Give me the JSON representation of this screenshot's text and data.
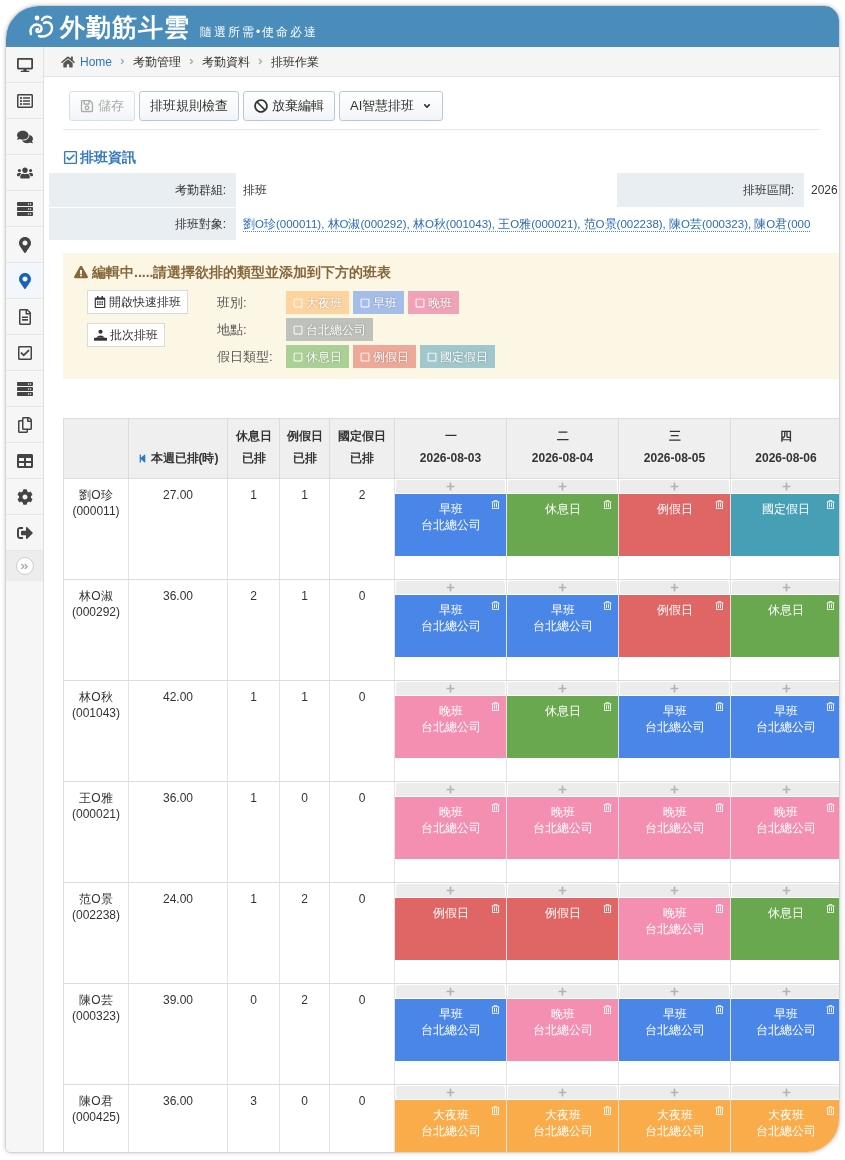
{
  "header": {
    "logo_text": "外勤筋斗雲",
    "tagline": "隨選所需•使命必達"
  },
  "sidebar": {
    "items": [
      {
        "selected": false
      },
      {
        "selected": false
      },
      {
        "selected": false
      },
      {
        "selected": false
      },
      {
        "selected": false
      },
      {
        "selected": false
      },
      {
        "selected": true
      },
      {
        "selected": false
      },
      {
        "selected": false
      },
      {
        "selected": false
      },
      {
        "selected": false
      },
      {
        "selected": false
      },
      {
        "selected": false
      },
      {
        "selected": false
      }
    ]
  },
  "breadcrumb": [
    "Home",
    "考勤管理",
    "考勤資料",
    "排班作業"
  ],
  "toolbar": [
    {
      "label": "儲存",
      "kind": "save",
      "disabled": true
    },
    {
      "label": "排班規則檢查",
      "kind": "check",
      "disabled": false
    },
    {
      "label": "放棄編輯",
      "kind": "discard",
      "disabled": false
    },
    {
      "label": "AI智慧排班",
      "kind": "dropdown",
      "disabled": false
    }
  ],
  "section_title": "排班資訊",
  "info": {
    "rows": [
      {
        "fields": [
          {
            "label": "考勤群組:",
            "value": "排班",
            "kind": "text"
          },
          {
            "label": "排班區間:",
            "value": "2026",
            "kind": "text"
          }
        ]
      },
      {
        "fields": [
          {
            "label": "排班對象:",
            "value": "劉O珍(000011), 林O淑(000292), 林O秋(001043), 王O雅(000021), 范O景(002238), 陳O芸(000323), 陳O君(000",
            "kind": "link"
          }
        ]
      }
    ]
  },
  "editor": {
    "message": "編輯中.....請選擇欲排的類型並添加到下方的班表",
    "buttons": [
      {
        "label": "開啟快速排班",
        "kind": "calendar"
      },
      {
        "label": "批次排班",
        "kind": "batch"
      }
    ],
    "groups": [
      {
        "label": "班別:",
        "options": [
          {
            "label": "大夜班",
            "color": "#fdd39e",
            "checked": false
          },
          {
            "label": "早班",
            "color": "#a4bee9",
            "checked": false
          },
          {
            "label": "晚班",
            "color": "#f0a3b7",
            "checked": false
          }
        ]
      },
      {
        "label": "地點:",
        "options": [
          {
            "label": "台北總公司",
            "color": "#bfc2bb",
            "checked": false
          }
        ]
      },
      {
        "label": "假日類型:",
        "options": [
          {
            "label": "休息日",
            "color": "#abd096",
            "checked": false
          },
          {
            "label": "例假日",
            "color": "#eda898",
            "checked": false
          },
          {
            "label": "國定假日",
            "color": "#a0c7cb",
            "checked": false
          }
        ]
      }
    ]
  },
  "schedule": {
    "summary_columns": [
      {
        "title": "本週已排(時)",
        "kind": "hours"
      },
      {
        "title": "休息日",
        "subtitle": "已排",
        "kind": "count"
      },
      {
        "title": "例假日",
        "subtitle": "已排",
        "kind": "count"
      },
      {
        "title": "國定假日",
        "subtitle": "已排",
        "kind": "count"
      }
    ],
    "days": [
      {
        "weekday": "一",
        "date": "2026-08-03"
      },
      {
        "weekday": "二",
        "date": "2026-08-04"
      },
      {
        "weekday": "三",
        "date": "2026-08-05"
      },
      {
        "weekday": "四",
        "date": "2026-08-06"
      }
    ],
    "rows": [
      {
        "name": "劉O珍",
        "code": "(000011)",
        "hours": "27.00",
        "rest_days": "1",
        "regular_off_days": "1",
        "holidays": "2",
        "shifts": [
          {
            "name": "早班",
            "location": "台北總公司",
            "color": "#4a86e8"
          },
          {
            "name": "休息日",
            "color": "#6aa84f"
          },
          {
            "name": "例假日",
            "color": "#e06666"
          },
          {
            "name": "國定假日",
            "color": "#469fb5"
          }
        ]
      },
      {
        "name": "林O淑",
        "code": "(000292)",
        "hours": "36.00",
        "rest_days": "2",
        "regular_off_days": "1",
        "holidays": "0",
        "shifts": [
          {
            "name": "早班",
            "location": "台北總公司",
            "color": "#4a86e8"
          },
          {
            "name": "早班",
            "location": "台北總公司",
            "color": "#4a86e8"
          },
          {
            "name": "例假日",
            "color": "#e06666"
          },
          {
            "name": "休息日",
            "color": "#6aa84f"
          }
        ]
      },
      {
        "name": "林O秋",
        "code": "(001043)",
        "hours": "42.00",
        "rest_days": "1",
        "regular_off_days": "1",
        "holidays": "0",
        "shifts": [
          {
            "name": "晚班",
            "location": "台北總公司",
            "color": "#f48fb1"
          },
          {
            "name": "休息日",
            "color": "#6aa84f"
          },
          {
            "name": "早班",
            "location": "台北總公司",
            "color": "#4a86e8"
          },
          {
            "name": "早班",
            "location": "台北總公司",
            "color": "#4a86e8"
          }
        ]
      },
      {
        "name": "王O雅",
        "code": "(000021)",
        "hours": "36.00",
        "rest_days": "1",
        "regular_off_days": "0",
        "holidays": "0",
        "shifts": [
          {
            "name": "晚班",
            "location": "台北總公司",
            "color": "#f48fb1"
          },
          {
            "name": "晚班",
            "location": "台北總公司",
            "color": "#f48fb1"
          },
          {
            "name": "晚班",
            "location": "台北總公司",
            "color": "#f48fb1"
          },
          {
            "name": "晚班",
            "location": "台北總公司",
            "color": "#f48fb1"
          }
        ]
      },
      {
        "name": "范O景",
        "code": "(002238)",
        "hours": "24.00",
        "rest_days": "1",
        "regular_off_days": "2",
        "holidays": "0",
        "shifts": [
          {
            "name": "例假日",
            "color": "#e06666"
          },
          {
            "name": "例假日",
            "color": "#e06666"
          },
          {
            "name": "晚班",
            "location": "台北總公司",
            "color": "#f48fb1"
          },
          {
            "name": "休息日",
            "color": "#6aa84f"
          }
        ]
      },
      {
        "name": "陳O芸",
        "code": "(000323)",
        "hours": "39.00",
        "rest_days": "0",
        "regular_off_days": "2",
        "holidays": "0",
        "shifts": [
          {
            "name": "早班",
            "location": "台北總公司",
            "color": "#4a86e8"
          },
          {
            "name": "晚班",
            "location": "台北總公司",
            "color": "#f48fb1"
          },
          {
            "name": "早班",
            "location": "台北總公司",
            "color": "#4a86e8"
          },
          {
            "name": "早班",
            "location": "台北總公司",
            "color": "#4a86e8"
          }
        ]
      },
      {
        "name": "陳O君",
        "code": "(000425)",
        "hours": "36.00",
        "rest_days": "3",
        "regular_off_days": "0",
        "holidays": "0",
        "shifts": [
          {
            "name": "大夜班",
            "location": "台北總公司",
            "color": "#fbac4a"
          },
          {
            "name": "大夜班",
            "location": "台北總公司",
            "color": "#fbac4a"
          },
          {
            "name": "大夜班",
            "location": "台北總公司",
            "color": "#fbac4a"
          },
          {
            "name": "大夜班",
            "location": "台北總公司",
            "color": "#fbac4a"
          }
        ]
      }
    ]
  }
}
